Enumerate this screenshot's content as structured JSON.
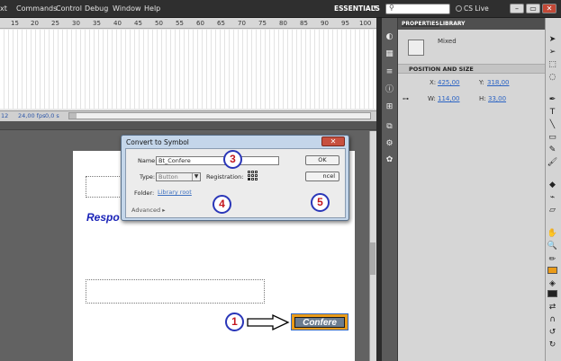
{
  "menubar": {
    "items": [
      "xt",
      "Commands",
      "Control",
      "Debug",
      "Window",
      "Help"
    ],
    "workspace": "ESSENTIALS",
    "search_placeholder": "",
    "cs_live": "CS Live"
  },
  "timeline": {
    "ruler_ticks": [
      "15",
      "20",
      "25",
      "30",
      "35",
      "40",
      "45",
      "50",
      "55",
      "60",
      "65",
      "70",
      "75",
      "80",
      "85",
      "90",
      "95",
      "100"
    ],
    "frame": "12",
    "fps": "24,00 fps",
    "time": "0,0 s"
  },
  "stage": {
    "question_text": "Respo",
    "button_label": "Confere"
  },
  "dialog": {
    "title": "Convert to Symbol",
    "name_label": "Name:",
    "name_value": "Bt_Confere",
    "type_label": "Type:",
    "type_value": "Button",
    "registration_label": "Registration:",
    "folder_label": "Folder:",
    "folder_value": "Library root",
    "advanced_label": "Advanced",
    "ok_label": "OK",
    "cancel_label": "ncel"
  },
  "annotations": {
    "step1": "1",
    "step3": "3",
    "step4": "4",
    "step5": "5"
  },
  "properties": {
    "tab_properties": "PROPERTIES",
    "tab_library": "LIBRARY",
    "instance_type": "Mixed",
    "section": "POSITION AND SIZE",
    "x_label": "X:",
    "x_value": "425,00",
    "y_label": "Y:",
    "y_value": "318,00",
    "w_label": "W:",
    "w_value": "114,00",
    "h_label": "H:",
    "h_value": "33,00"
  },
  "colors": {
    "accent_blue": "#2a36b8",
    "step_number_red": "#c4171e",
    "button_fill": "#ea9b18"
  },
  "icons": [
    "search-icon",
    "selection-tool-icon",
    "subselection-tool-icon",
    "free-transform-icon",
    "lasso-icon",
    "pen-icon",
    "text-icon",
    "line-icon",
    "rectangle-icon",
    "pencil-icon",
    "brush-icon",
    "paint-bucket-icon",
    "eyedropper-icon",
    "eraser-icon",
    "hand-icon",
    "zoom-icon",
    "stroke-color-icon",
    "fill-color-icon",
    "swap-colors-icon"
  ]
}
